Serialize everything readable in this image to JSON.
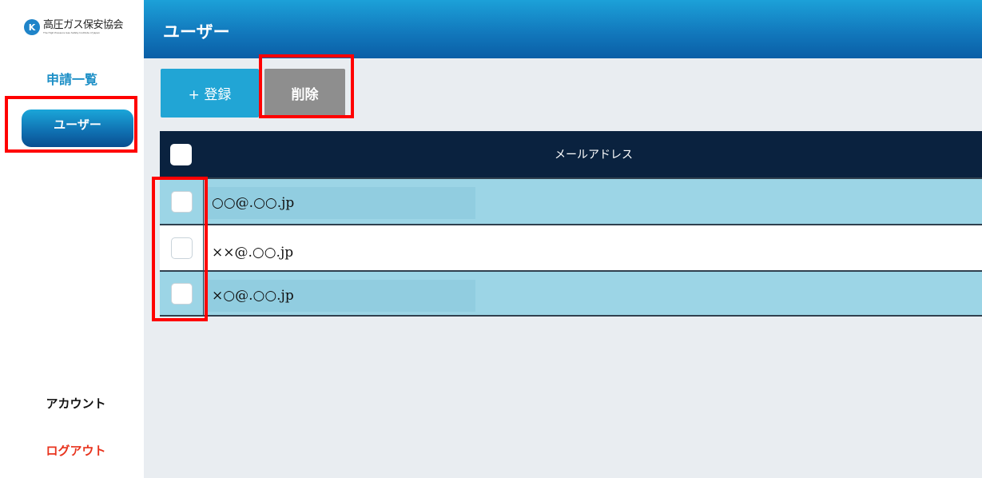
{
  "brand": {
    "mark": "K",
    "name": "高圧ガス保安協会",
    "subtitle": "The High Pressure Gas Safety Institute of Japan"
  },
  "sidebar": {
    "items": [
      {
        "label": "申請一覧"
      },
      {
        "label": "ユーザー"
      },
      {
        "label": "アカウント"
      },
      {
        "label": "ログアウト"
      }
    ]
  },
  "header": {
    "title": "ユーザー"
  },
  "toolbar": {
    "register_label": "+ 登録",
    "delete_label": "削除"
  },
  "table": {
    "columns": [
      "メールアドレス"
    ],
    "rows": [
      {
        "email": "○○@.○○.jp",
        "checked": false
      },
      {
        "email": "××@.○○.jp",
        "checked": false
      },
      {
        "email": "×○@.○○.jp",
        "checked": false
      }
    ]
  },
  "colors": {
    "accent": "#1d8fc6",
    "header_dark": "#0a223f",
    "row_shaded": "#9cd5e6",
    "delete_button": "#8e8e8e",
    "logout": "#e8331d",
    "highlight": "#ff0000"
  }
}
